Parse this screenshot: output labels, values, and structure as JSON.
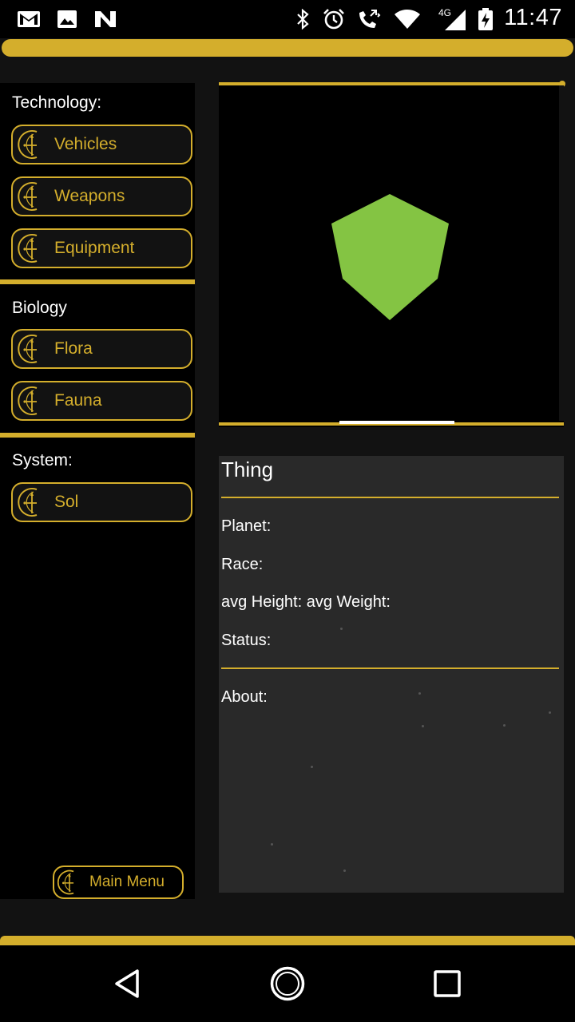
{
  "status_bar": {
    "time": "11:47",
    "network": "4G",
    "left_icons": [
      "gmail-icon",
      "gallery-icon",
      "n-app-icon"
    ],
    "right_icons": [
      "bluetooth-icon",
      "alarm-icon",
      "call-forward-icon",
      "wifi-icon",
      "cell-signal-icon",
      "battery-charging-icon"
    ]
  },
  "theme": {
    "accent": "#d4ae2c",
    "background": "#121212",
    "panel": "#292929",
    "cube": "#84c443"
  },
  "sidebar": {
    "technology_label": "Technology:",
    "technology_items": [
      {
        "label": "Vehicles"
      },
      {
        "label": "Weapons"
      },
      {
        "label": "Equipment"
      }
    ],
    "biology_label": "Biology",
    "biology_items": [
      {
        "label": "Flora"
      },
      {
        "label": "Fauna"
      }
    ],
    "system_label": "System:",
    "system_items": [
      {
        "label": "Sol"
      }
    ],
    "main_menu_label": "Main Menu"
  },
  "viewer": {
    "model": "green cube"
  },
  "info": {
    "title": "Thing",
    "planet_label": "Planet:",
    "race_label": "Race:",
    "size_label": "avg Height: avg Weight:",
    "status_label": "Status:",
    "about_label": "About:"
  },
  "nav_bar": {
    "icons": [
      "back-icon",
      "home-icon",
      "recents-icon"
    ]
  }
}
